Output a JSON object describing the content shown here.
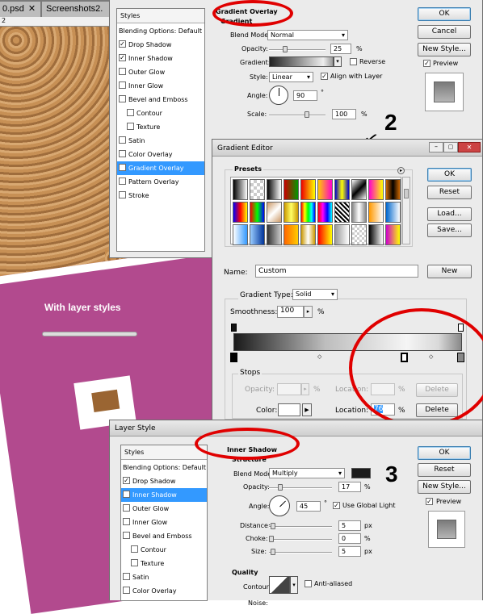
{
  "tabs": [
    "0.psd",
    "Screenshots2."
  ],
  "ruler_label": "2",
  "canvas_caption": "With layer styles",
  "annotations": [
    "2",
    "3"
  ],
  "top_layer_style": {
    "styles_header": "Styles",
    "items": [
      {
        "label": "Blending Options: Default",
        "checkbox": false,
        "checked": false,
        "selected": false,
        "indent": 0
      },
      {
        "label": "Drop Shadow",
        "checkbox": true,
        "checked": true,
        "selected": false,
        "indent": 0
      },
      {
        "label": "Inner Shadow",
        "checkbox": true,
        "checked": true,
        "selected": false,
        "indent": 0
      },
      {
        "label": "Outer Glow",
        "checkbox": true,
        "checked": false,
        "selected": false,
        "indent": 0
      },
      {
        "label": "Inner Glow",
        "checkbox": true,
        "checked": false,
        "selected": false,
        "indent": 0
      },
      {
        "label": "Bevel and Emboss",
        "checkbox": true,
        "checked": false,
        "selected": false,
        "indent": 0
      },
      {
        "label": "Contour",
        "checkbox": true,
        "checked": false,
        "selected": false,
        "indent": 1
      },
      {
        "label": "Texture",
        "checkbox": true,
        "checked": false,
        "selected": false,
        "indent": 1
      },
      {
        "label": "Satin",
        "checkbox": true,
        "checked": false,
        "selected": false,
        "indent": 0
      },
      {
        "label": "Color Overlay",
        "checkbox": true,
        "checked": false,
        "selected": false,
        "indent": 0
      },
      {
        "label": "Gradient Overlay",
        "checkbox": true,
        "checked": true,
        "selected": true,
        "indent": 0
      },
      {
        "label": "Pattern Overlay",
        "checkbox": true,
        "checked": false,
        "selected": false,
        "indent": 0
      },
      {
        "label": "Stroke",
        "checkbox": true,
        "checked": false,
        "selected": false,
        "indent": 0
      }
    ],
    "section_title": "Gradient Overlay",
    "subsection": "Gradient",
    "blend_mode_label": "Blend Mode:",
    "blend_mode": "Normal",
    "opacity_label": "Opacity:",
    "opacity": "25",
    "opacity_level": 0.25,
    "gradient_label": "Gradient:",
    "reverse_label": "Reverse",
    "style_label": "Style:",
    "style": "Linear",
    "align_label": "Align with Layer",
    "angle_label": "Angle:",
    "angle": "90",
    "scale_label": "Scale:",
    "scale": "100",
    "pct": "%",
    "deg": "°",
    "ok": "OK",
    "cancel": "Cancel",
    "new_style": "New Style...",
    "preview": "Preview"
  },
  "gradient_editor": {
    "title": "Gradient Editor",
    "presets_label": "Presets",
    "ok": "OK",
    "reset": "Reset",
    "load": "Load...",
    "save": "Save...",
    "name_label": "Name:",
    "name": "Custom",
    "new": "New",
    "type_label": "Gradient Type:",
    "type": "Solid",
    "smoothness_label": "Smoothness:",
    "smoothness": "100",
    "pct": "%",
    "stops_label": "Stops",
    "opacity_label": "Opacity:",
    "location_label": "Location:",
    "delete": "Delete",
    "color_label": "Color:",
    "location": "76"
  },
  "bottom_layer_style": {
    "title": "Layer Style",
    "styles_header": "Styles",
    "items": [
      {
        "label": "Blending Options: Default",
        "checkbox": false,
        "checked": false,
        "selected": false,
        "indent": 0
      },
      {
        "label": "Drop Shadow",
        "checkbox": true,
        "checked": true,
        "selected": false,
        "indent": 0
      },
      {
        "label": "Inner Shadow",
        "checkbox": true,
        "checked": true,
        "selected": true,
        "indent": 0
      },
      {
        "label": "Outer Glow",
        "checkbox": true,
        "checked": false,
        "selected": false,
        "indent": 0
      },
      {
        "label": "Inner Glow",
        "checkbox": true,
        "checked": false,
        "selected": false,
        "indent": 0
      },
      {
        "label": "Bevel and Emboss",
        "checkbox": true,
        "checked": false,
        "selected": false,
        "indent": 0
      },
      {
        "label": "Contour",
        "checkbox": true,
        "checked": false,
        "selected": false,
        "indent": 1
      },
      {
        "label": "Texture",
        "checkbox": true,
        "checked": false,
        "selected": false,
        "indent": 1
      },
      {
        "label": "Satin",
        "checkbox": true,
        "checked": false,
        "selected": false,
        "indent": 0
      },
      {
        "label": "Color Overlay",
        "checkbox": true,
        "checked": false,
        "selected": false,
        "indent": 0
      }
    ],
    "section_title": "Inner Shadow",
    "structure": "Structure",
    "blend_mode_label": "Blend Mode:",
    "blend_mode": "Multiply",
    "opacity_label": "Opacity:",
    "opacity": "17",
    "opacity_level": 0.17,
    "angle_label": "Angle:",
    "angle": "45",
    "global_light": "Use Global Light",
    "distance_label": "Distance:",
    "distance": "5",
    "choke_label": "Choke:",
    "choke": "0",
    "size_label": "Size:",
    "size": "5",
    "px": "px",
    "pct": "%",
    "deg": "°",
    "quality": "Quality",
    "contour_label": "Contour:",
    "anti_aliased": "Anti-aliased",
    "noise_label": "Noise:",
    "ok": "OK",
    "reset": "Reset",
    "new_style": "New Style...",
    "preview": "Preview"
  },
  "colors": {
    "selection": "#3399ff",
    "dialog_bg": "#ebebeb",
    "red_annotation": "#e00000",
    "magenta": "#b24a8e",
    "cork": "#b07a40"
  }
}
